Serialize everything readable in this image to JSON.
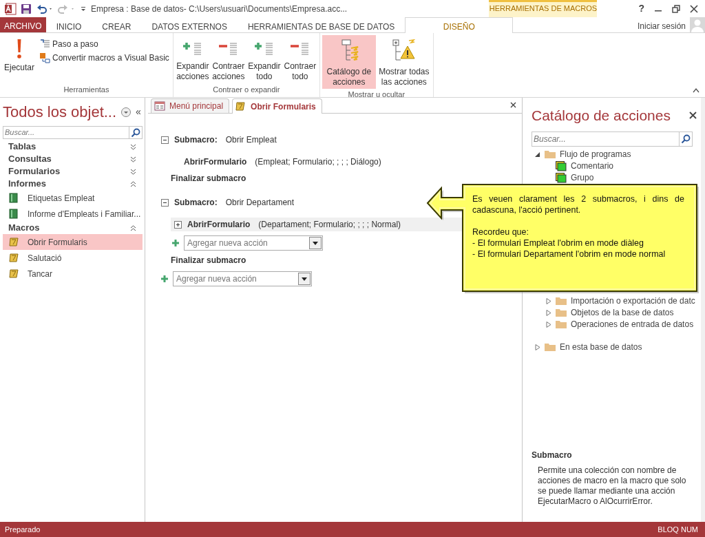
{
  "window": {
    "title": "Empresa : Base de datos- C:\\Users\\usuari\\Documents\\Empresa.acc...",
    "contextual_tab": "HERRAMIENTAS DE MACROS",
    "help": "?"
  },
  "ribbon": {
    "file_tab": "ARCHIVO",
    "account": "Iniciar sesión",
    "tabs": [
      {
        "label": "INICIO",
        "selected": false
      },
      {
        "label": "CREAR",
        "selected": false
      },
      {
        "label": "DATOS EXTERNOS",
        "selected": false
      },
      {
        "label": "HERRAMIENTAS DE BASE DE DATOS",
        "selected": false
      },
      {
        "label": "DISEÑO",
        "selected": true
      }
    ],
    "groups": [
      {
        "label": "Herramientas",
        "buttons": [
          {
            "label": "Ejecutar",
            "kind": "large",
            "selected": false
          },
          {
            "label": "Paso a paso",
            "kind": "small"
          },
          {
            "label": "Convertir macros a Visual Basic",
            "kind": "small"
          }
        ]
      },
      {
        "label": "Contraer o expandir",
        "buttons": [
          {
            "label": "Expandir acciones",
            "kind": "large",
            "selected": false
          },
          {
            "label": "Contraer acciones",
            "kind": "large",
            "selected": false
          },
          {
            "label": "Expandir todo",
            "kind": "large",
            "selected": false
          },
          {
            "label": "Contraer todo",
            "kind": "large",
            "selected": false
          }
        ]
      },
      {
        "label": "Mostrar u ocultar",
        "buttons": [
          {
            "label": "Catálogo de acciones",
            "kind": "large",
            "selected": true
          },
          {
            "label": "Mostrar todas las acciones",
            "kind": "large",
            "selected": false
          }
        ]
      }
    ]
  },
  "nav": {
    "title": "Todos los objet...",
    "collapse_button": "«",
    "search": {
      "placeholder": "Buscar..."
    },
    "groups": [
      {
        "label": "Tablas",
        "expanded": false
      },
      {
        "label": "Consultas",
        "expanded": false
      },
      {
        "label": "Formularios",
        "expanded": false
      },
      {
        "label": "Informes",
        "expanded": true,
        "items": [
          {
            "label": "Etiquetas Empleat",
            "kind": "report",
            "selected": false
          },
          {
            "label": "Informe d'Empleats i Familiar...",
            "kind": "report",
            "selected": false
          }
        ]
      },
      {
        "label": "Macros",
        "expanded": true,
        "items": [
          {
            "label": "Obrir Formularis",
            "kind": "macro",
            "selected": true
          },
          {
            "label": "Salutació",
            "kind": "macro",
            "selected": false
          },
          {
            "label": "Tancar",
            "kind": "macro",
            "selected": false
          }
        ]
      }
    ]
  },
  "document": {
    "tabs": [
      {
        "label": "Menú principal",
        "kind": "form",
        "selected": false
      },
      {
        "label": "Obrir Formularis",
        "kind": "macro",
        "selected": true
      }
    ],
    "submacros": [
      {
        "keyword": "Submacro:",
        "name": "Obrir Empleat",
        "expanded": true,
        "actions": [
          {
            "name": "AbrirFormulario",
            "args": "(Empleat; Formulario; ; ; ; Diálogo)",
            "selected": false
          }
        ],
        "end": "Finalizar submacro"
      },
      {
        "keyword": "Submacro:",
        "name": "Obrir Departament",
        "expanded": true,
        "actions": [
          {
            "name": "AbrirFormulario",
            "args": "(Departament; Formulario; ; ; ; Normal)",
            "selected": true
          }
        ],
        "add_action": {
          "placeholder": "Agregar nueva acción"
        },
        "end": "Finalizar submacro"
      }
    ],
    "add_action": {
      "placeholder": "Agregar nueva acción"
    }
  },
  "catalog": {
    "title": "Catálogo de acciones",
    "search": {
      "placeholder": "Buscar..."
    },
    "tree": [
      {
        "label": "Flujo de programas",
        "kind": "folder",
        "expanded": true,
        "children": [
          {
            "label": "Comentario",
            "kind": "action"
          },
          {
            "label": "Grupo",
            "kind": "action"
          }
        ]
      },
      {
        "kind": "hidden",
        "children": [
          {
            "label": "Importación o exportación de datc",
            "kind": "folder",
            "expanded": false
          },
          {
            "label": "Objetos de la base de datos",
            "kind": "folder",
            "expanded": false
          },
          {
            "label": "Operaciones de entrada de datos",
            "kind": "folder",
            "expanded": false
          }
        ]
      },
      {
        "label": "En esta base de datos",
        "kind": "folder",
        "expanded": false
      }
    ],
    "help_title": "Submacro",
    "help_text": "Permite una colección con nombre de acciones de macro en la macro que solo se puede llamar mediante una acción EjecutarMacro o AlOcurrirError."
  },
  "callout": {
    "paragraphs": [
      "Es veuen clarament les 2 submacros, i dins de cadascuna, l'acció pertinent.",
      "Recordeu que:",
      "- El formulari Empleat l'obrim en mode diàleg",
      "- El formulari Departament l'obrim en mode normal"
    ]
  },
  "status_bar": {
    "left": "Preparado",
    "right": "BLOQ NUM"
  }
}
